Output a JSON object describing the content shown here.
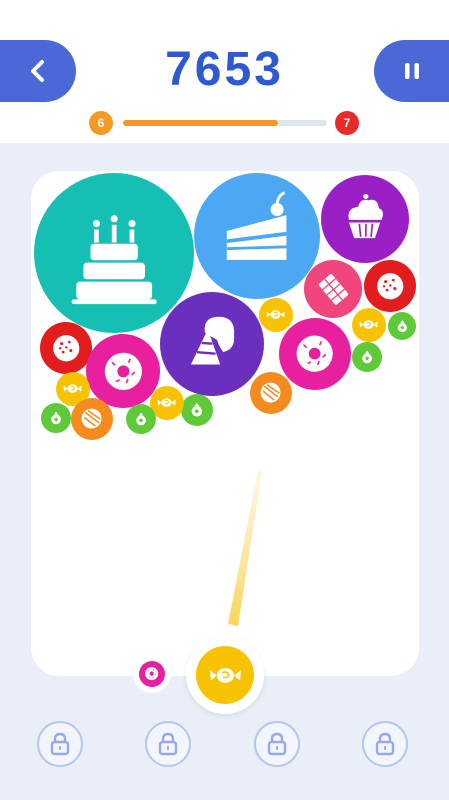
{
  "header": {
    "score": "7653",
    "level_current": "6",
    "level_next": "7",
    "level_progress": 0.76,
    "back_icon": "chevron-left-icon",
    "pause_icon": "pause-icon"
  },
  "colors": {
    "accent_blue": "#4a69d6",
    "score_blue": "#2f58d3",
    "progress_orange": "#f39a25",
    "next_level_red": "#e72a2a",
    "teal": "#16bfb3",
    "sky": "#4da8f4",
    "purple": "#9a1fc4",
    "violet": "#6b2fbd",
    "pink": "#f0467b",
    "magenta": "#e8209f",
    "red": "#e31d1d",
    "orange": "#f58a1e",
    "yellow": "#f7c200",
    "green": "#5fc93a"
  },
  "board": {
    "bubbles": [
      {
        "kind": "cake",
        "color": "teal"
      },
      {
        "kind": "cake-slice",
        "color": "sky"
      },
      {
        "kind": "cupcake",
        "color": "purple"
      },
      {
        "kind": "cookie",
        "color": "red"
      },
      {
        "kind": "chocolate",
        "color": "pink"
      },
      {
        "kind": "ice-cream",
        "color": "violet"
      },
      {
        "kind": "candy",
        "color": "yellow"
      },
      {
        "kind": "donut",
        "color": "magenta"
      },
      {
        "kind": "candy",
        "color": "yellow"
      },
      {
        "kind": "bonbon",
        "color": "green"
      },
      {
        "kind": "cookie",
        "color": "red"
      },
      {
        "kind": "donut",
        "color": "magenta"
      },
      {
        "kind": "bonbon",
        "color": "green"
      },
      {
        "kind": "candy",
        "color": "yellow"
      },
      {
        "kind": "lollipop",
        "color": "orange"
      },
      {
        "kind": "bonbon",
        "color": "green"
      },
      {
        "kind": "lollipop",
        "color": "orange"
      },
      {
        "kind": "bonbon",
        "color": "green"
      },
      {
        "kind": "candy",
        "color": "yellow"
      },
      {
        "kind": "bonbon",
        "color": "green"
      }
    ]
  },
  "shooter": {
    "current": {
      "kind": "candy",
      "color": "yellow"
    },
    "next": {
      "kind": "donut",
      "color": "magenta"
    }
  },
  "boosters": [
    {
      "name": "booster-slot-1",
      "icon": "lock-icon",
      "locked": true
    },
    {
      "name": "booster-slot-2",
      "icon": "lock-icon",
      "locked": true
    },
    {
      "name": "booster-slot-3",
      "icon": "lock-icon",
      "locked": true
    },
    {
      "name": "booster-slot-4",
      "icon": "lock-icon",
      "locked": true
    }
  ]
}
